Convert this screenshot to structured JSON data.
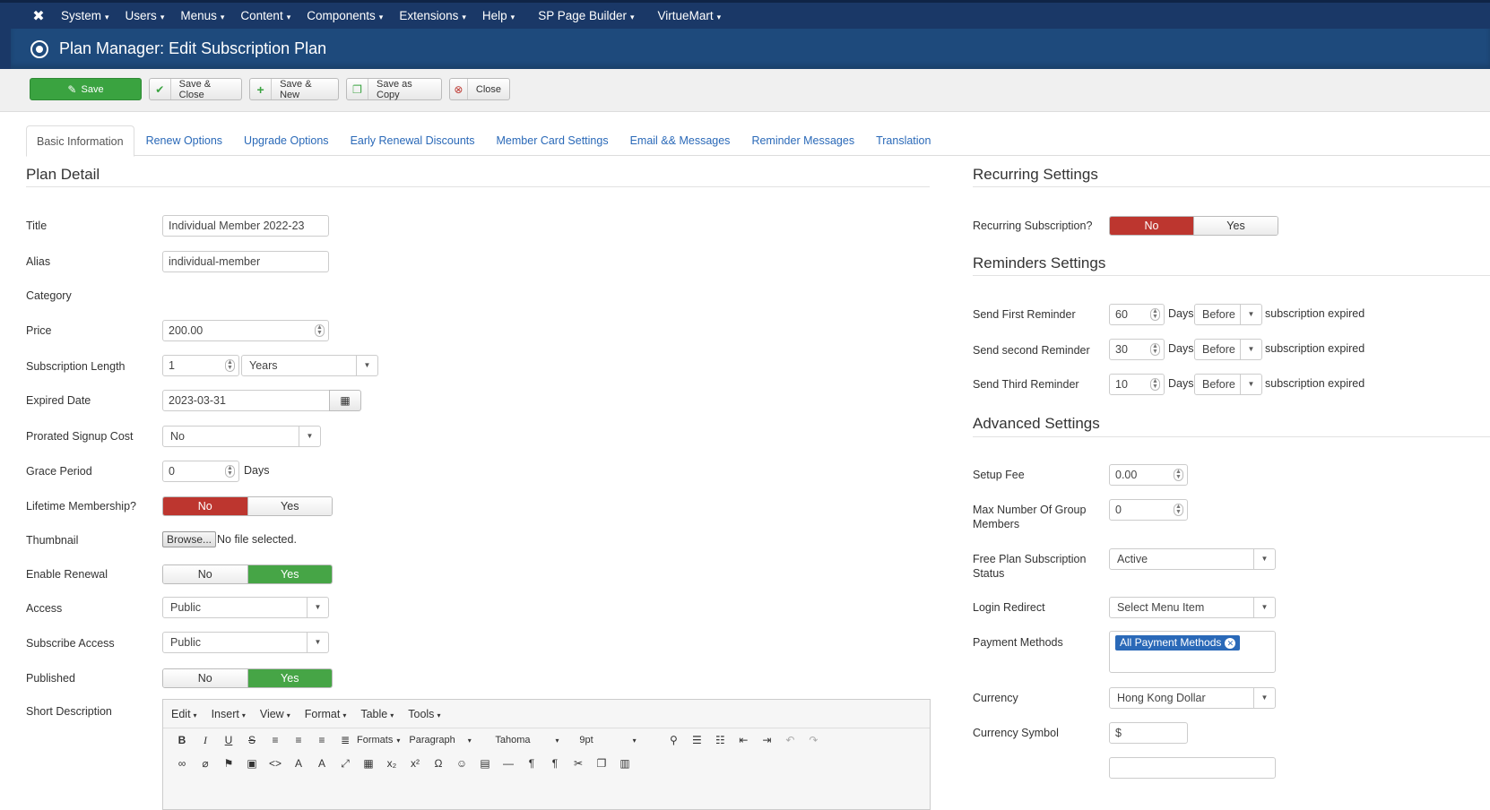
{
  "topnav": {
    "logo": "joomla-logo",
    "items": [
      {
        "label": "System",
        "caret": "▾"
      },
      {
        "label": "Users",
        "caret": "▾"
      },
      {
        "label": "Menus",
        "caret": "▾"
      },
      {
        "label": "Content",
        "caret": "▾"
      },
      {
        "label": "Components",
        "caret": "▾"
      },
      {
        "label": "Extensions",
        "caret": "▾"
      },
      {
        "label": "Help",
        "caret": "▾"
      },
      {
        "label": "SP Page Builder",
        "caret": "▾"
      },
      {
        "label": "VirtueMart",
        "caret": "▾"
      }
    ]
  },
  "header": {
    "title": "Plan Manager: Edit Subscription Plan"
  },
  "toolbar": {
    "save": "Save",
    "save_close": "Save & Close",
    "save_new": "Save & New",
    "save_copy": "Save as Copy",
    "close": "Close"
  },
  "tabs": [
    "Basic Information",
    "Renew Options",
    "Upgrade Options",
    "Early Renewal Discounts",
    "Member Card Settings",
    "Email && Messages",
    "Reminder Messages",
    "Translation"
  ],
  "plan": {
    "section": "Plan Detail",
    "title_label": "Title",
    "title_value": "Individual Member 2022-23",
    "alias_label": "Alias",
    "alias_value": "individual-member",
    "category_label": "Category",
    "price_label": "Price",
    "price_value": "200.00",
    "length_label": "Subscription Length",
    "length_value": "1",
    "length_unit": "Years",
    "expired_label": "Expired Date",
    "expired_value": "2023-03-31",
    "prorated_label": "Prorated Signup Cost",
    "prorated_value": "No",
    "grace_label": "Grace Period",
    "grace_value": "0",
    "grace_unit": "Days",
    "lifetime_label": "Lifetime Membership?",
    "thumb_label": "Thumbnail",
    "browse": "Browse...",
    "no_file": "No file selected.",
    "renewal_label": "Enable Renewal",
    "access_label": "Access",
    "access_value": "Public",
    "subaccess_label": "Subscribe Access",
    "subaccess_value": "Public",
    "published_label": "Published",
    "shortdesc_label": "Short Description",
    "no": "No",
    "yes": "Yes"
  },
  "editor": {
    "menus": [
      "Edit",
      "Insert",
      "View",
      "Format",
      "Table",
      "Tools"
    ],
    "formats": "Formats",
    "paragraph": "Paragraph",
    "font": "Tahoma",
    "size": "9pt",
    "caret": "▾"
  },
  "recurring": {
    "section": "Recurring Settings",
    "label": "Recurring Subscription?"
  },
  "reminders": {
    "section": "Reminders Settings",
    "rows": [
      {
        "label": "Send First Reminder",
        "value": "60"
      },
      {
        "label": "Send second Reminder",
        "value": "30"
      },
      {
        "label": "Send Third Reminder",
        "value": "10"
      }
    ],
    "days": "Days",
    "when": "Before",
    "suffix": "subscription expired"
  },
  "advanced": {
    "section": "Advanced Settings",
    "setup_label": "Setup Fee",
    "setup_value": "0.00",
    "maxgroup_label1": "Max Number Of Group",
    "maxgroup_label2": "Members",
    "maxgroup_value": "0",
    "free_label1": "Free Plan Subscription",
    "free_label2": "Status",
    "free_value": "Active",
    "login_label": "Login Redirect",
    "login_value": "Select Menu Item",
    "payment_label": "Payment Methods",
    "payment_tag": "All Payment Methods",
    "currency_label": "Currency",
    "currency_value": "Hong Kong Dollar",
    "symbol_label": "Currency Symbol",
    "symbol_value": "$"
  }
}
